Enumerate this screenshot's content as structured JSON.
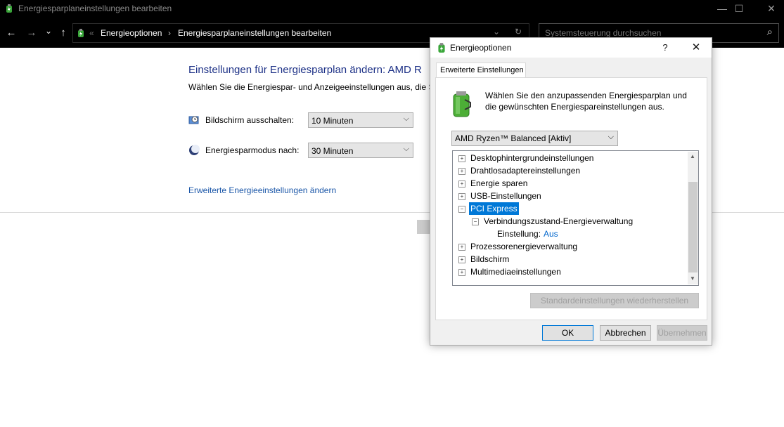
{
  "window": {
    "title": "Energiesparplaneinstellungen bearbeiten",
    "controls": {
      "minimize": "—",
      "maximize": "☐",
      "close": "✕"
    }
  },
  "nav": {
    "back": "←",
    "forward": "→",
    "recent": "⌄",
    "up": "↑",
    "overflow": "«",
    "breadcrumb": [
      "Energieoptionen",
      "Energiesparplaneinstellungen bearbeiten"
    ],
    "refresh": "↻",
    "dropdown": "⌄",
    "search_placeholder": "Systemsteuerung durchsuchen",
    "search_icon": "⌕"
  },
  "main": {
    "title": "Einstellungen für Energiesparplan ändern: AMD R",
    "subtitle": "Wählen Sie die Energiespar- und Anzeigeeinstellungen aus, die Si",
    "display_off_label": "Bildschirm ausschalten:",
    "display_off_value": "10 Minuten",
    "sleep_label": "Energiesparmodus nach:",
    "sleep_value": "30 Minuten",
    "advanced_link": "Erweiterte Energieeinstellungen ändern"
  },
  "dialog": {
    "title": "Energieoptionen",
    "help": "?",
    "close": "✕",
    "tab": "Erweiterte Einstellungen",
    "description": "Wählen Sie den anzupassenden Energiesparplan und die gewünschten Energiespareinstellungen aus.",
    "plan": "AMD Ryzen™ Balanced [Aktiv]",
    "tree": [
      {
        "label": "Desktophintergrundeinstellungen",
        "expander": "+"
      },
      {
        "label": "Drahtlosadaptereinstellungen",
        "expander": "+"
      },
      {
        "label": "Energie sparen",
        "expander": "+"
      },
      {
        "label": "USB-Einstellungen",
        "expander": "+"
      },
      {
        "label": "PCI Express",
        "expander": "−"
      },
      {
        "label": "Verbindungszustand-Energieverwaltung",
        "expander": "−"
      },
      {
        "label": "Einstellung:",
        "value": "Aus"
      },
      {
        "label": "Prozessorenergieverwaltung",
        "expander": "+"
      },
      {
        "label": "Bildschirm",
        "expander": "+"
      },
      {
        "label": "Multimediaeinstellungen",
        "expander": "+"
      }
    ],
    "scroll_up": "▲",
    "scroll_down": "▼",
    "restore_button": "Standardeinstellungen wiederherstellen",
    "ok_button": "OK",
    "cancel_button": "Abbrechen",
    "apply_button": "Übernehmen"
  }
}
